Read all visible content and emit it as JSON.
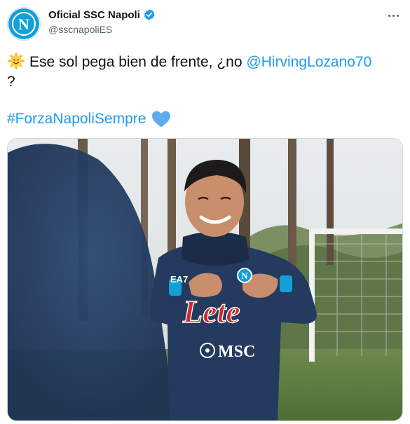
{
  "account": {
    "display_name": "Oficial SSC Napoli",
    "handle": "@sscnapoliES",
    "avatar_letter": "N",
    "verified_icon": "verified-badge-icon"
  },
  "tweet": {
    "text_before": "Ese sol pega bien de frente, ¿no ",
    "mention": "@HirvingLozano70",
    "text_after": "?",
    "hashtag": "#ForzaNapoliSempre",
    "leading_emoji": "sun-with-face-emoji",
    "trailing_emoji": "blue-heart-emoji"
  },
  "media": {
    "kit_sponsor": "Lete",
    "kit_sponsor_2": "MSC",
    "kit_brand": "EA7",
    "crest_letter": "N"
  },
  "colors": {
    "link": "#1d9bf0",
    "napoli_blue": "#12a0d7",
    "kit_navy": "#243a5e"
  }
}
